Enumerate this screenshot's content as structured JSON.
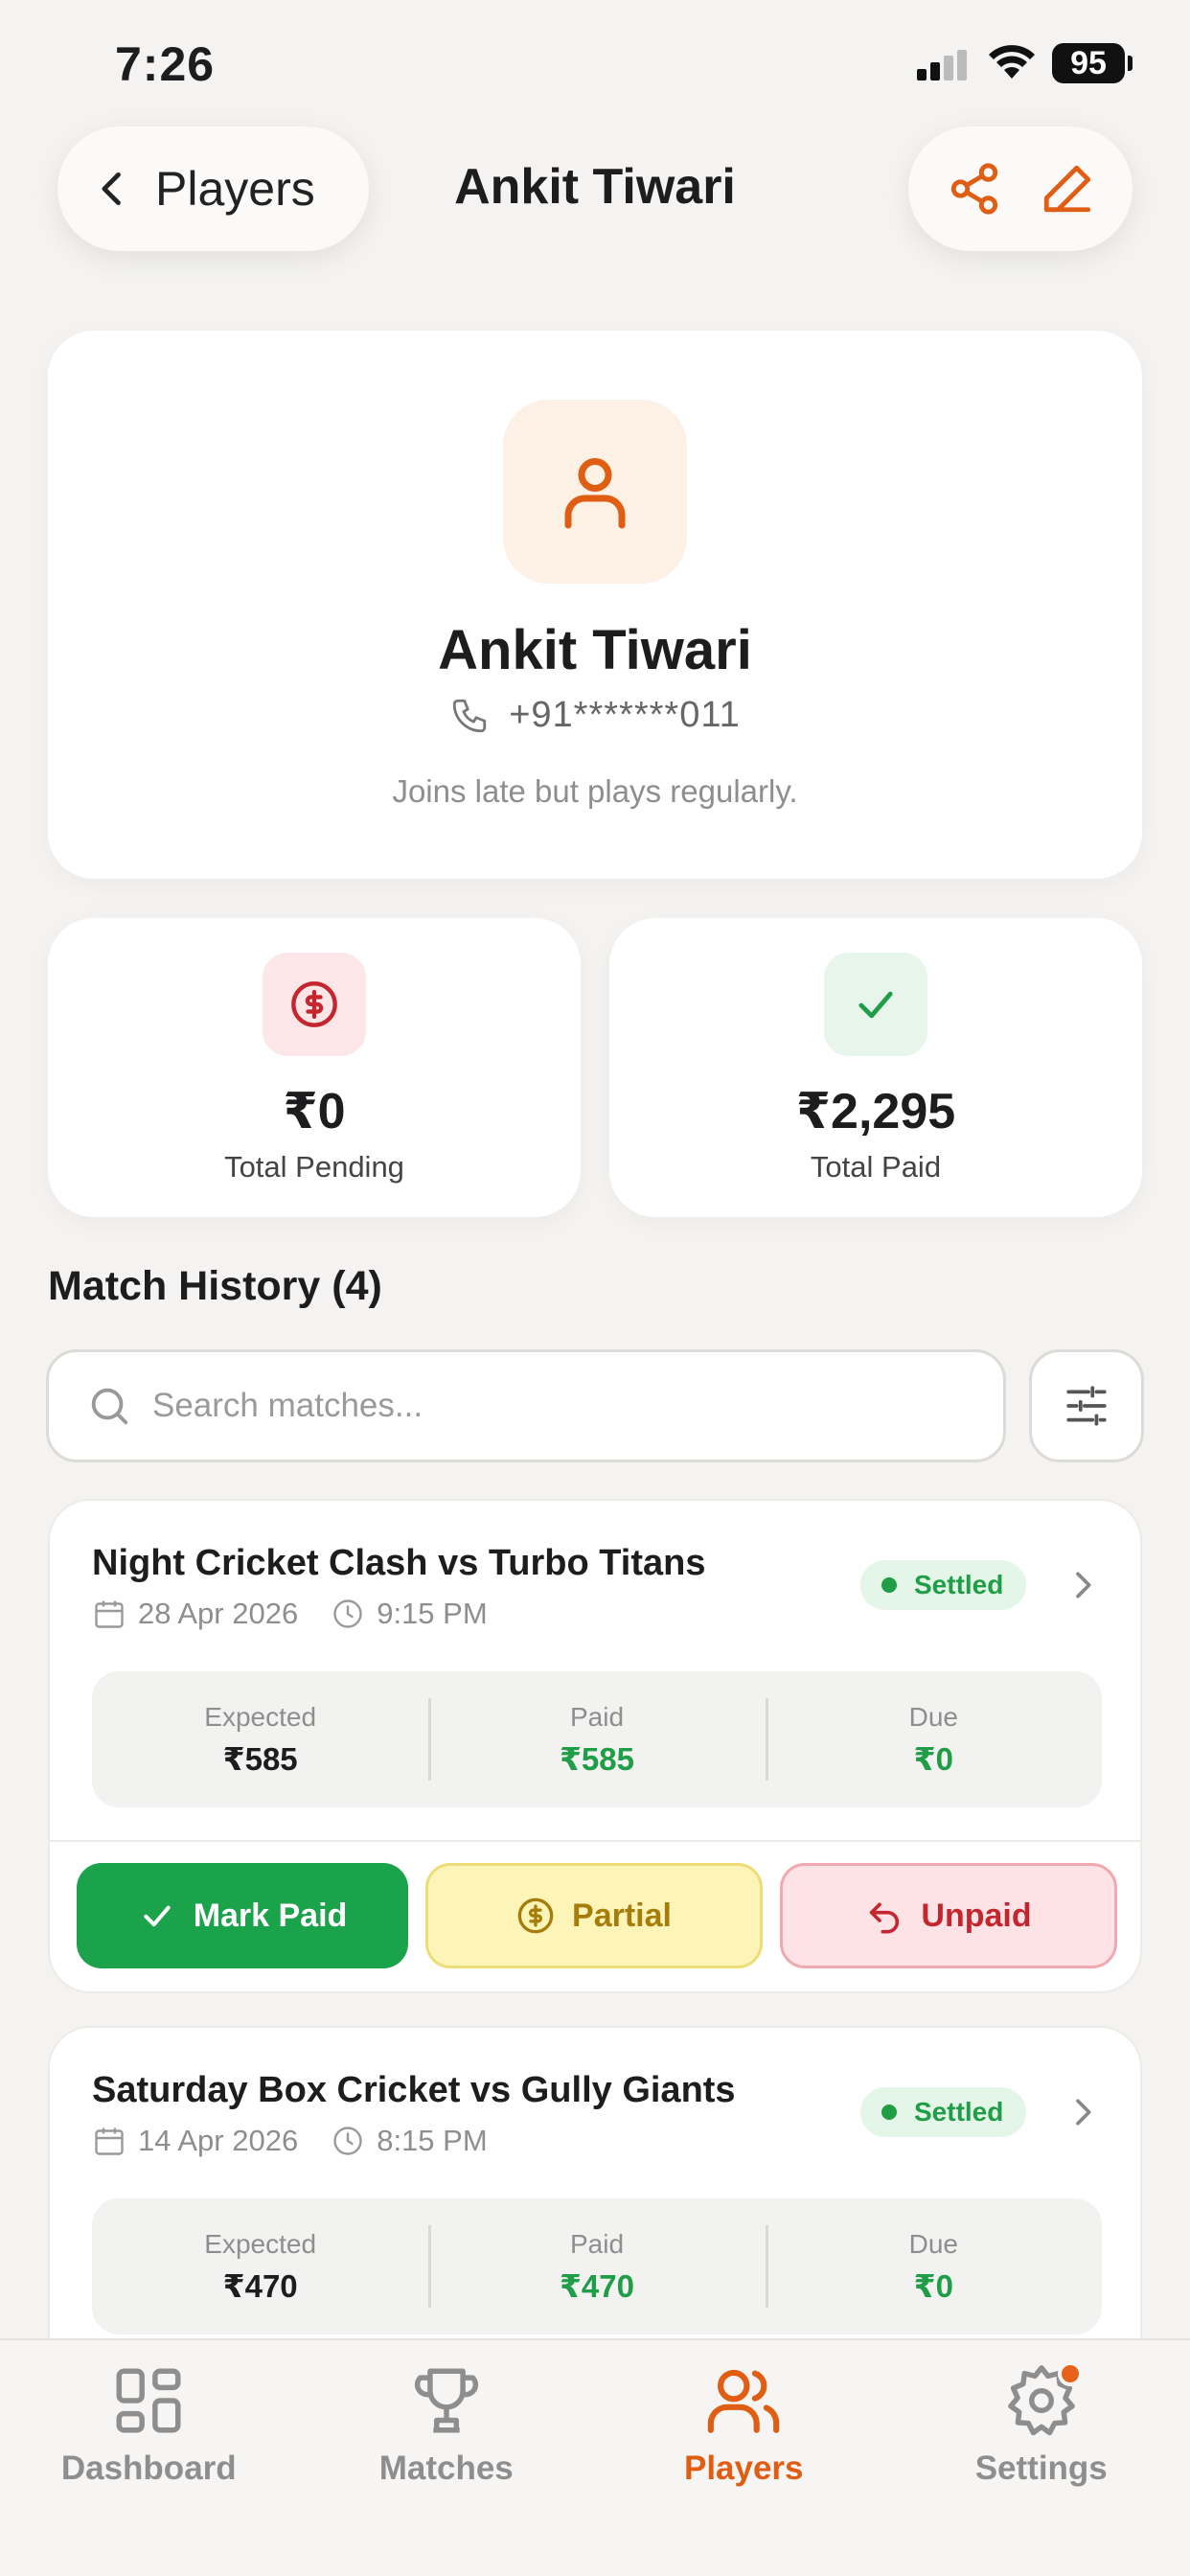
{
  "status_bar": {
    "time": "7:26",
    "battery": "95"
  },
  "header": {
    "back_label": "Players",
    "title": "Ankit Tiwari"
  },
  "profile": {
    "name": "Ankit Tiwari",
    "phone": "+91*******011",
    "note": "Joins late but plays regularly."
  },
  "stats": {
    "pending": {
      "value": "₹0",
      "label": "Total Pending"
    },
    "paid": {
      "value": "₹2,295",
      "label": "Total Paid"
    }
  },
  "history": {
    "title": "Match History (4)",
    "search_placeholder": "Search matches...",
    "matches": [
      {
        "title": "Night Cricket Clash vs Turbo Titans",
        "date": "28 Apr 2026",
        "time": "9:15 PM",
        "status": "Settled",
        "expected_label": "Expected",
        "expected": "₹585",
        "paid_label": "Paid",
        "paid": "₹585",
        "due_label": "Due",
        "due": "₹0",
        "actions": {
          "mark_paid": "Mark Paid",
          "partial": "Partial",
          "unpaid": "Unpaid"
        }
      },
      {
        "title": "Saturday Box Cricket vs Gully Giants",
        "date": "14 Apr 2026",
        "time": "8:15 PM",
        "status": "Settled",
        "expected_label": "Expected",
        "expected": "₹470",
        "paid_label": "Paid",
        "paid": "₹470",
        "due_label": "Due",
        "due": "₹0"
      }
    ]
  },
  "tabs": [
    {
      "label": "Dashboard",
      "icon": "dashboard-icon"
    },
    {
      "label": "Matches",
      "icon": "trophy-icon"
    },
    {
      "label": "Players",
      "icon": "users-icon",
      "active": true
    },
    {
      "label": "Settings",
      "icon": "gear-icon"
    }
  ],
  "colors": {
    "accent": "#e05d14",
    "success": "#1f9d47",
    "danger": "#c4262f",
    "warning": "#a67c0a"
  }
}
